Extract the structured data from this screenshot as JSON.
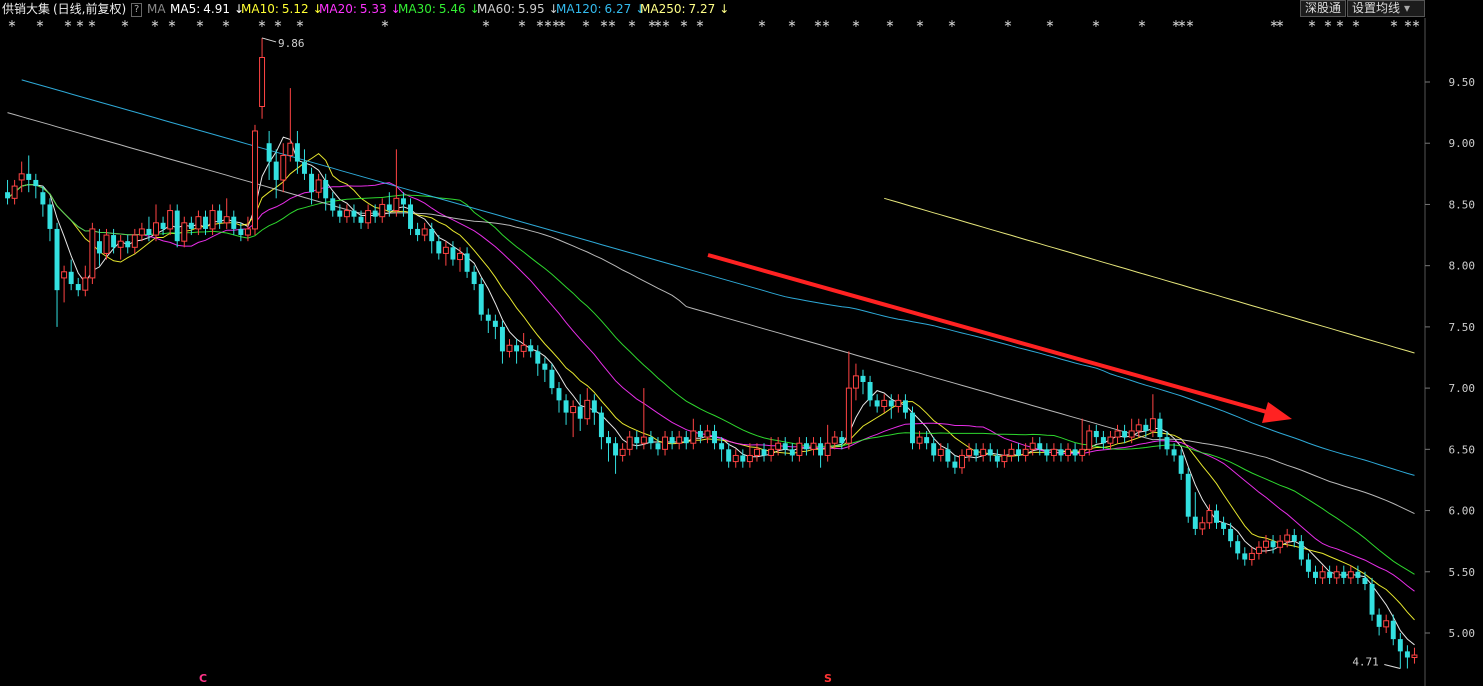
{
  "header": {
    "stock_name": "供销大集",
    "period": "(日线,前复权)",
    "help": "?",
    "ma_tag": "MA",
    "ma_items": [
      {
        "label": "MA5:",
        "value": "4.91",
        "arrow": "↓",
        "color": "#ffffff"
      },
      {
        "label": "MA10:",
        "value": "5.12",
        "arrow": "↓",
        "color": "#ffff33"
      },
      {
        "label": "MA20:",
        "value": "5.33",
        "arrow": "↓",
        "color": "#ff33ff"
      },
      {
        "label": "MA30:",
        "value": "5.46",
        "arrow": "↓",
        "color": "#33ee33"
      },
      {
        "label": "MA60:",
        "value": "5.95",
        "arrow": "↓",
        "color": "#cccccc"
      },
      {
        "label": "MA120:",
        "value": "6.27",
        "arrow": "↓",
        "color": "#33bbee"
      },
      {
        "label": "MA250:",
        "value": "7.27",
        "arrow": "↓",
        "color": "#ffff88"
      }
    ],
    "btn_exchange": "深股通",
    "btn_settings": "设置均线",
    "settings_arrow": "▾"
  },
  "chart_data": {
    "type": "candlestick",
    "y_ticks": [
      "9.50",
      "9.00",
      "8.50",
      "8.00",
      "7.50",
      "7.00",
      "6.50",
      "6.00",
      "5.50",
      "5.00"
    ],
    "ylim": [
      4.6,
      10.0
    ],
    "high_label": "9.86",
    "low_label": "4.71",
    "bottom_markers": [
      "C",
      "S"
    ],
    "trend_arrow": {
      "from": [
        0,
        8.1
      ],
      "to": [
        1,
        6.9
      ]
    },
    "candles": [
      [
        8.6,
        8.55,
        8.7,
        8.5
      ],
      [
        8.55,
        8.65,
        8.7,
        8.5
      ],
      [
        8.7,
        8.75,
        8.85,
        8.6
      ],
      [
        8.75,
        8.7,
        8.9,
        8.6
      ],
      [
        8.7,
        8.65,
        8.75,
        8.55
      ],
      [
        8.6,
        8.5,
        8.65,
        8.4
      ],
      [
        8.5,
        8.3,
        8.55,
        8.2
      ],
      [
        8.3,
        7.8,
        8.35,
        7.5
      ],
      [
        7.9,
        7.95,
        8.0,
        7.7
      ],
      [
        7.95,
        7.85,
        8.05,
        7.8
      ],
      [
        7.85,
        7.8,
        7.9,
        7.75
      ],
      [
        7.8,
        7.9,
        8.0,
        7.75
      ],
      [
        7.9,
        8.3,
        8.35,
        7.85
      ],
      [
        8.2,
        8.1,
        8.3,
        8.0
      ],
      [
        8.1,
        8.25,
        8.3,
        8.05
      ],
      [
        8.25,
        8.15,
        8.3,
        8.1
      ],
      [
        8.15,
        8.2,
        8.25,
        8.05
      ],
      [
        8.2,
        8.15,
        8.25,
        8.1
      ],
      [
        8.15,
        8.25,
        8.3,
        8.1
      ],
      [
        8.25,
        8.3,
        8.35,
        8.2
      ],
      [
        8.3,
        8.25,
        8.4,
        8.2
      ],
      [
        8.25,
        8.35,
        8.5,
        8.2
      ],
      [
        8.35,
        8.3,
        8.4,
        8.25
      ],
      [
        8.3,
        8.45,
        8.5,
        8.25
      ],
      [
        8.45,
        8.2,
        8.5,
        8.15
      ],
      [
        8.2,
        8.35,
        8.4,
        8.15
      ],
      [
        8.35,
        8.3,
        8.4,
        8.25
      ],
      [
        8.3,
        8.4,
        8.45,
        8.25
      ],
      [
        8.4,
        8.3,
        8.45,
        8.25
      ],
      [
        8.3,
        8.45,
        8.5,
        8.25
      ],
      [
        8.45,
        8.35,
        8.5,
        8.3
      ],
      [
        8.35,
        8.4,
        8.55,
        8.3
      ],
      [
        8.4,
        8.3,
        8.45,
        8.25
      ],
      [
        8.3,
        8.25,
        8.35,
        8.2
      ],
      [
        8.25,
        8.3,
        8.4,
        8.2
      ],
      [
        8.3,
        9.1,
        9.15,
        8.25
      ],
      [
        9.3,
        9.7,
        9.86,
        9.2
      ],
      [
        9.0,
        8.85,
        9.1,
        8.7
      ],
      [
        8.85,
        8.7,
        8.95,
        8.55
      ],
      [
        8.7,
        8.9,
        9.0,
        8.6
      ],
      [
        8.9,
        9.0,
        9.45,
        8.85
      ],
      [
        9.0,
        8.85,
        9.1,
        8.75
      ],
      [
        8.85,
        8.75,
        8.95,
        8.7
      ],
      [
        8.75,
        8.6,
        8.8,
        8.5
      ],
      [
        8.6,
        8.7,
        8.75,
        8.55
      ],
      [
        8.7,
        8.55,
        8.75,
        8.45
      ],
      [
        8.55,
        8.45,
        8.6,
        8.4
      ],
      [
        8.45,
        8.4,
        8.5,
        8.35
      ],
      [
        8.4,
        8.45,
        8.5,
        8.35
      ],
      [
        8.45,
        8.4,
        8.5,
        8.35
      ],
      [
        8.4,
        8.35,
        8.45,
        8.3
      ],
      [
        8.35,
        8.45,
        8.5,
        8.3
      ],
      [
        8.45,
        8.4,
        8.5,
        8.35
      ],
      [
        8.4,
        8.5,
        8.55,
        8.35
      ],
      [
        8.5,
        8.45,
        8.6,
        8.4
      ],
      [
        8.45,
        8.55,
        8.95,
        8.4
      ],
      [
        8.55,
        8.5,
        8.6,
        8.4
      ],
      [
        8.5,
        8.3,
        8.55,
        8.25
      ],
      [
        8.3,
        8.25,
        8.35,
        8.2
      ],
      [
        8.25,
        8.3,
        8.35,
        8.2
      ],
      [
        8.3,
        8.2,
        8.35,
        8.1
      ],
      [
        8.2,
        8.1,
        8.25,
        8.05
      ],
      [
        8.1,
        8.15,
        8.2,
        8.0
      ],
      [
        8.15,
        8.05,
        8.2,
        8.0
      ],
      [
        8.05,
        8.1,
        8.15,
        7.95
      ],
      [
        8.1,
        7.95,
        8.15,
        7.9
      ],
      [
        7.95,
        7.85,
        8.0,
        7.8
      ],
      [
        7.85,
        7.6,
        7.9,
        7.55
      ],
      [
        7.6,
        7.55,
        7.65,
        7.45
      ],
      [
        7.55,
        7.5,
        7.6,
        7.4
      ],
      [
        7.5,
        7.3,
        7.55,
        7.2
      ],
      [
        7.3,
        7.35,
        7.4,
        7.25
      ],
      [
        7.35,
        7.3,
        7.4,
        7.2
      ],
      [
        7.3,
        7.35,
        7.45,
        7.25
      ],
      [
        7.35,
        7.3,
        7.4,
        7.25
      ],
      [
        7.3,
        7.2,
        7.35,
        7.1
      ],
      [
        7.2,
        7.15,
        7.25,
        7.05
      ],
      [
        7.15,
        7.0,
        7.2,
        6.95
      ],
      [
        7.0,
        6.9,
        7.05,
        6.8
      ],
      [
        6.9,
        6.8,
        6.95,
        6.7
      ],
      [
        6.8,
        6.85,
        6.9,
        6.6
      ],
      [
        6.85,
        6.75,
        6.95,
        6.65
      ],
      [
        6.75,
        6.9,
        7.0,
        6.7
      ],
      [
        6.9,
        6.8,
        6.95,
        6.7
      ],
      [
        6.8,
        6.6,
        6.85,
        6.5
      ],
      [
        6.6,
        6.55,
        6.65,
        6.4
      ],
      [
        6.55,
        6.45,
        6.6,
        6.3
      ],
      [
        6.45,
        6.5,
        6.55,
        6.4
      ],
      [
        6.5,
        6.6,
        6.65,
        6.45
      ],
      [
        6.6,
        6.55,
        6.65,
        6.5
      ],
      [
        6.55,
        6.6,
        7.0,
        6.5
      ],
      [
        6.6,
        6.55,
        6.65,
        6.5
      ],
      [
        6.55,
        6.5,
        6.6,
        6.45
      ],
      [
        6.5,
        6.6,
        6.65,
        6.45
      ],
      [
        6.6,
        6.55,
        6.65,
        6.5
      ],
      [
        6.55,
        6.6,
        6.65,
        6.5
      ],
      [
        6.6,
        6.55,
        6.65,
        6.5
      ],
      [
        6.55,
        6.65,
        6.75,
        6.5
      ],
      [
        6.65,
        6.6,
        6.7,
        6.55
      ],
      [
        6.6,
        6.65,
        6.7,
        6.55
      ],
      [
        6.65,
        6.55,
        6.7,
        6.5
      ],
      [
        6.55,
        6.5,
        6.6,
        6.4
      ],
      [
        6.5,
        6.4,
        6.55,
        6.35
      ],
      [
        6.4,
        6.45,
        6.5,
        6.35
      ],
      [
        6.45,
        6.4,
        6.5,
        6.35
      ],
      [
        6.4,
        6.45,
        6.55,
        6.35
      ],
      [
        6.45,
        6.5,
        6.55,
        6.4
      ],
      [
        6.5,
        6.45,
        6.55,
        6.4
      ],
      [
        6.45,
        6.5,
        6.6,
        6.4
      ],
      [
        6.5,
        6.55,
        6.6,
        6.45
      ],
      [
        6.55,
        6.5,
        6.6,
        6.45
      ],
      [
        6.5,
        6.45,
        6.55,
        6.4
      ],
      [
        6.45,
        6.55,
        6.6,
        6.4
      ],
      [
        6.55,
        6.5,
        6.6,
        6.45
      ],
      [
        6.5,
        6.55,
        6.6,
        6.45
      ],
      [
        6.55,
        6.45,
        6.6,
        6.35
      ],
      [
        6.45,
        6.55,
        6.7,
        6.4
      ],
      [
        6.55,
        6.6,
        6.65,
        6.5
      ],
      [
        6.6,
        6.55,
        6.65,
        6.5
      ],
      [
        6.55,
        7.0,
        7.3,
        6.5
      ],
      [
        7.0,
        7.1,
        7.2,
        6.9
      ],
      [
        7.1,
        7.05,
        7.15,
        6.95
      ],
      [
        7.05,
        6.9,
        7.1,
        6.85
      ],
      [
        6.9,
        6.85,
        6.95,
        6.8
      ],
      [
        6.85,
        6.9,
        6.95,
        6.8
      ],
      [
        6.9,
        6.85,
        6.95,
        6.75
      ],
      [
        6.85,
        6.9,
        6.95,
        6.8
      ],
      [
        6.9,
        6.8,
        6.95,
        6.75
      ],
      [
        6.8,
        6.55,
        6.85,
        6.5
      ],
      [
        6.55,
        6.6,
        6.65,
        6.5
      ],
      [
        6.6,
        6.55,
        6.65,
        6.5
      ],
      [
        6.55,
        6.45,
        6.6,
        6.4
      ],
      [
        6.45,
        6.5,
        6.55,
        6.4
      ],
      [
        6.5,
        6.4,
        6.55,
        6.35
      ],
      [
        6.4,
        6.35,
        6.45,
        6.3
      ],
      [
        6.35,
        6.45,
        6.5,
        6.3
      ],
      [
        6.45,
        6.5,
        6.55,
        6.4
      ],
      [
        6.5,
        6.45,
        6.55,
        6.4
      ],
      [
        6.45,
        6.5,
        6.55,
        6.4
      ],
      [
        6.5,
        6.45,
        6.55,
        6.4
      ],
      [
        6.45,
        6.4,
        6.5,
        6.35
      ],
      [
        6.4,
        6.45,
        6.5,
        6.35
      ],
      [
        6.45,
        6.5,
        6.55,
        6.4
      ],
      [
        6.5,
        6.45,
        6.55,
        6.4
      ],
      [
        6.45,
        6.5,
        6.55,
        6.4
      ],
      [
        6.5,
        6.55,
        6.6,
        6.45
      ],
      [
        6.55,
        6.5,
        6.6,
        6.45
      ],
      [
        6.5,
        6.45,
        6.55,
        6.4
      ],
      [
        6.45,
        6.5,
        6.55,
        6.4
      ],
      [
        6.5,
        6.45,
        6.55,
        6.4
      ],
      [
        6.45,
        6.5,
        6.55,
        6.4
      ],
      [
        6.5,
        6.45,
        6.55,
        6.4
      ],
      [
        6.45,
        6.5,
        6.75,
        6.4
      ],
      [
        6.5,
        6.65,
        6.7,
        6.45
      ],
      [
        6.65,
        6.6,
        6.7,
        6.55
      ],
      [
        6.6,
        6.55,
        6.65,
        6.5
      ],
      [
        6.55,
        6.6,
        6.65,
        6.5
      ],
      [
        6.6,
        6.65,
        6.7,
        6.55
      ],
      [
        6.65,
        6.6,
        6.7,
        6.55
      ],
      [
        6.6,
        6.65,
        6.75,
        6.55
      ],
      [
        6.65,
        6.7,
        6.75,
        6.6
      ],
      [
        6.7,
        6.65,
        6.75,
        6.6
      ],
      [
        6.65,
        6.75,
        6.95,
        6.6
      ],
      [
        6.75,
        6.6,
        6.8,
        6.5
      ],
      [
        6.6,
        6.5,
        6.65,
        6.45
      ],
      [
        6.5,
        6.45,
        6.55,
        6.4
      ],
      [
        6.45,
        6.3,
        6.5,
        6.25
      ],
      [
        6.3,
        5.95,
        6.35,
        5.9
      ],
      [
        5.95,
        5.85,
        6.15,
        5.8
      ],
      [
        5.85,
        5.9,
        5.95,
        5.8
      ],
      [
        5.9,
        6.0,
        6.05,
        5.85
      ],
      [
        6.0,
        5.9,
        6.05,
        5.85
      ],
      [
        5.9,
        5.85,
        5.95,
        5.8
      ],
      [
        5.85,
        5.75,
        5.9,
        5.7
      ],
      [
        5.75,
        5.65,
        5.8,
        5.6
      ],
      [
        5.65,
        5.6,
        5.7,
        5.55
      ],
      [
        5.6,
        5.65,
        5.7,
        5.55
      ],
      [
        5.65,
        5.7,
        5.75,
        5.6
      ],
      [
        5.7,
        5.75,
        5.8,
        5.65
      ],
      [
        5.75,
        5.7,
        5.8,
        5.65
      ],
      [
        5.7,
        5.75,
        5.8,
        5.65
      ],
      [
        5.75,
        5.8,
        5.85,
        5.7
      ],
      [
        5.8,
        5.75,
        5.85,
        5.7
      ],
      [
        5.75,
        5.6,
        5.8,
        5.55
      ],
      [
        5.6,
        5.5,
        5.65,
        5.45
      ],
      [
        5.5,
        5.45,
        5.55,
        5.4
      ],
      [
        5.45,
        5.5,
        5.55,
        5.4
      ],
      [
        5.5,
        5.45,
        5.55,
        5.4
      ],
      [
        5.45,
        5.5,
        5.55,
        5.4
      ],
      [
        5.5,
        5.45,
        5.55,
        5.4
      ],
      [
        5.45,
        5.5,
        5.55,
        5.4
      ],
      [
        5.5,
        5.45,
        5.55,
        5.4
      ],
      [
        5.45,
        5.4,
        5.5,
        5.35
      ],
      [
        5.4,
        5.15,
        5.45,
        5.1
      ],
      [
        5.15,
        5.05,
        5.2,
        4.98
      ],
      [
        5.05,
        5.1,
        5.15,
        5.0
      ],
      [
        5.1,
        4.95,
        5.15,
        4.9
      ],
      [
        4.95,
        4.85,
        5.0,
        4.71
      ],
      [
        4.85,
        4.8,
        4.9,
        4.71
      ],
      [
        4.8,
        4.82,
        4.88,
        4.75
      ]
    ]
  }
}
